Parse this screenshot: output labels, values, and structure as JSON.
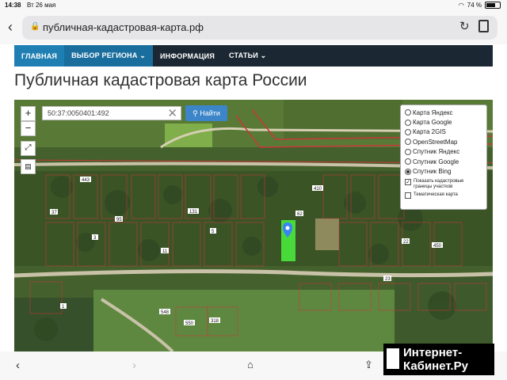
{
  "status_bar": {
    "time": "14:38",
    "date": "Вт 26 мая",
    "battery": "74 %"
  },
  "browser": {
    "url": "публичная-кадастровая-карта.рф"
  },
  "nav": {
    "items": [
      {
        "label": "ГЛАВНАЯ"
      },
      {
        "label": "ВЫБОР РЕГИОНА ⌄"
      },
      {
        "label": "ИНФОРМАЦИЯ"
      },
      {
        "label": "СТАТЬИ ⌄"
      }
    ]
  },
  "page": {
    "title": "Публичная кадастровая карта России"
  },
  "map": {
    "search_value": "50:37:0050401:492",
    "find_label": "Найти",
    "zoom_in": "+",
    "zoom_out": "−",
    "layers": [
      {
        "label": "Карта Яндекс"
      },
      {
        "label": "Карта Google"
      },
      {
        "label": "Карта 2GIS"
      },
      {
        "label": "OpenStreetMap"
      },
      {
        "label": "Спутник Яндекс"
      },
      {
        "label": "Спутник Google"
      },
      {
        "label": "Спутник Bing"
      }
    ],
    "options": [
      {
        "label": "Показать кадастровые границы участков"
      },
      {
        "label": "Тематическая карта"
      }
    ],
    "parcel_labels": [
      {
        "text": "443"
      },
      {
        "text": "37"
      },
      {
        "text": "95"
      },
      {
        "text": "131"
      },
      {
        "text": "11"
      },
      {
        "text": "62"
      },
      {
        "text": "410"
      },
      {
        "text": "450"
      },
      {
        "text": "548"
      },
      {
        "text": "550"
      },
      {
        "text": "318"
      },
      {
        "text": "1"
      },
      {
        "text": "3"
      },
      {
        "text": "5"
      },
      {
        "text": "22"
      },
      {
        "text": "23"
      }
    ]
  },
  "watermark": {
    "line1": "Интернет-",
    "line2": "Кабинет.Ру"
  }
}
